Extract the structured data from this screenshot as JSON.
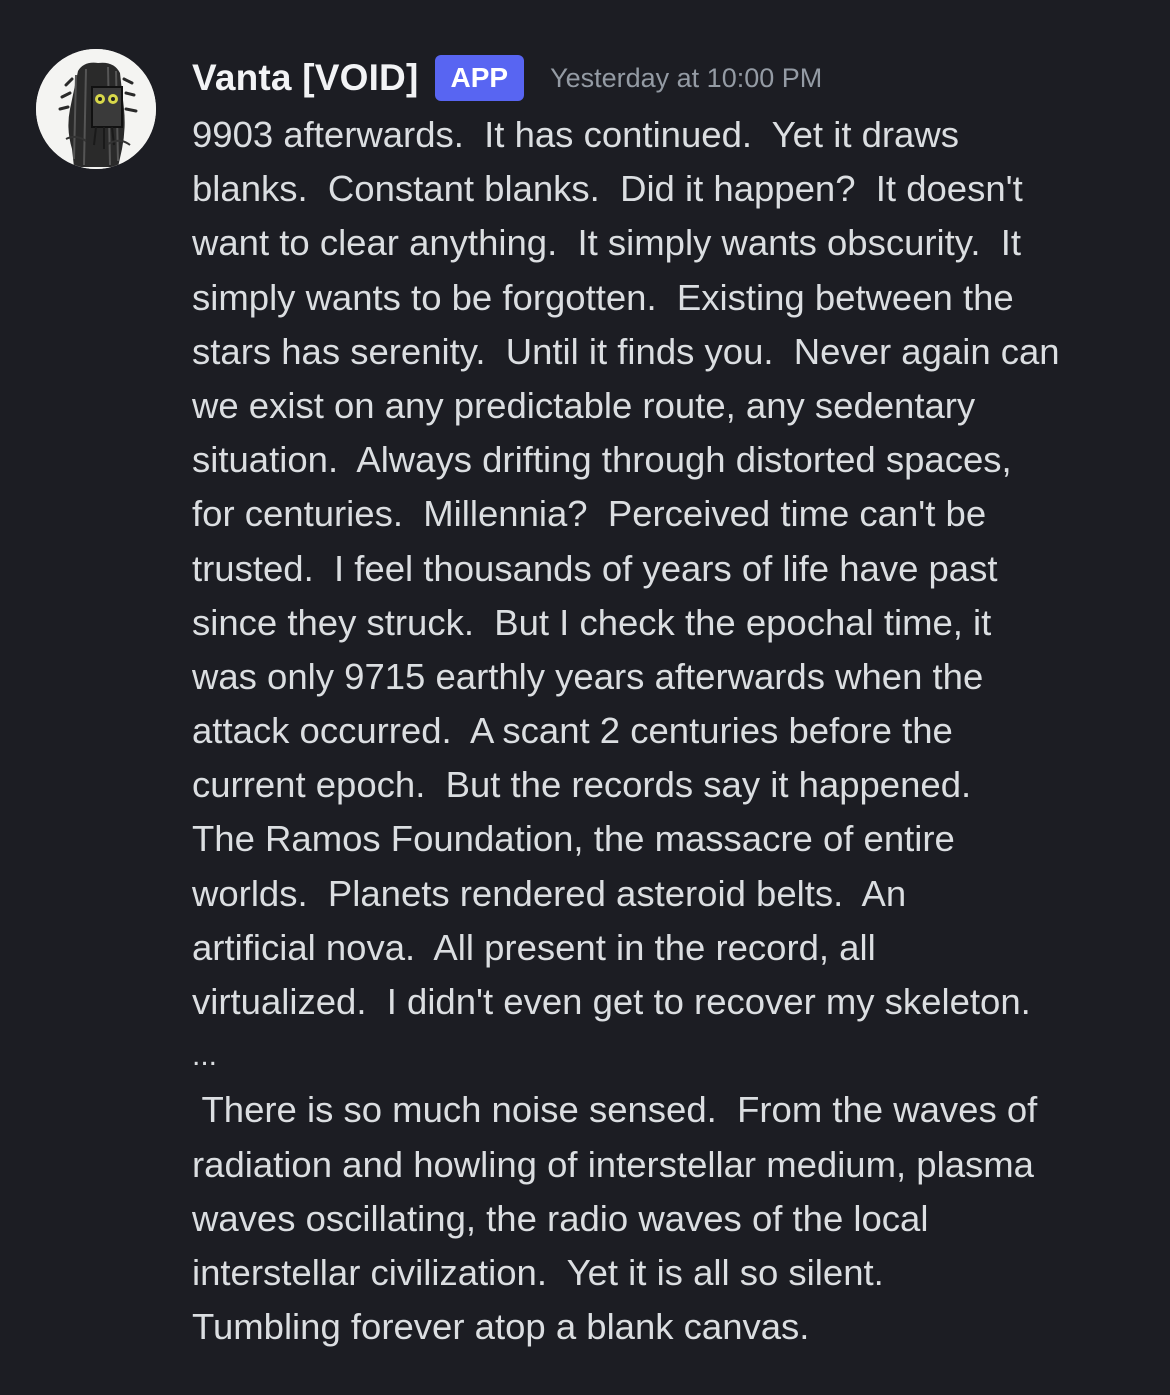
{
  "message": {
    "username": "Vanta [VOID]",
    "badge": "APP",
    "timestamp": "Yesterday at 10:00 PM",
    "lines": [
      "9903 afterwards.  It has continued.  Yet it draws",
      "blanks.  Constant blanks.  Did it happen?  It doesn't",
      "want to clear anything.  It simply wants obscurity.  It",
      "simply wants to be forgotten.  Existing between the",
      "stars has serenity.  Until it finds you.  Never again can",
      "we exist on any predictable route, any sedentary",
      "situation.  Always drifting through distorted spaces,",
      "for centuries.  Millennia?  Perceived time can't be",
      "trusted.  I feel thousands of years of life have past",
      "since they struck.  But I check the epochal time, it",
      "was only 9715 earthly years afterwards when the",
      "attack occurred.  A scant 2 centuries before the",
      "current epoch.  But the records say it happened.",
      "The Ramos Foundation, the massacre of entire",
      "worlds.  Planets rendered asteroid belts.  An",
      "artificial nova.  All present in the record, all",
      "virtualized.  I didn't even get to recover my skeleton.",
      "...",
      " There is so much noise sensed.  From the waves of",
      "radiation and howling of interstellar medium, plasma",
      "waves oscillating, the radio waves of the local",
      "interstellar civilization.  Yet it is all so silent.",
      "Tumbling forever atop a blank canvas."
    ]
  },
  "colors": {
    "background": "#1c1d23",
    "username": "#f2f3f5",
    "badge": "#5865f2",
    "timestamp": "#949ba4",
    "text": "#dbdee1"
  },
  "icons": {
    "avatar": "robot-figure-avatar"
  }
}
